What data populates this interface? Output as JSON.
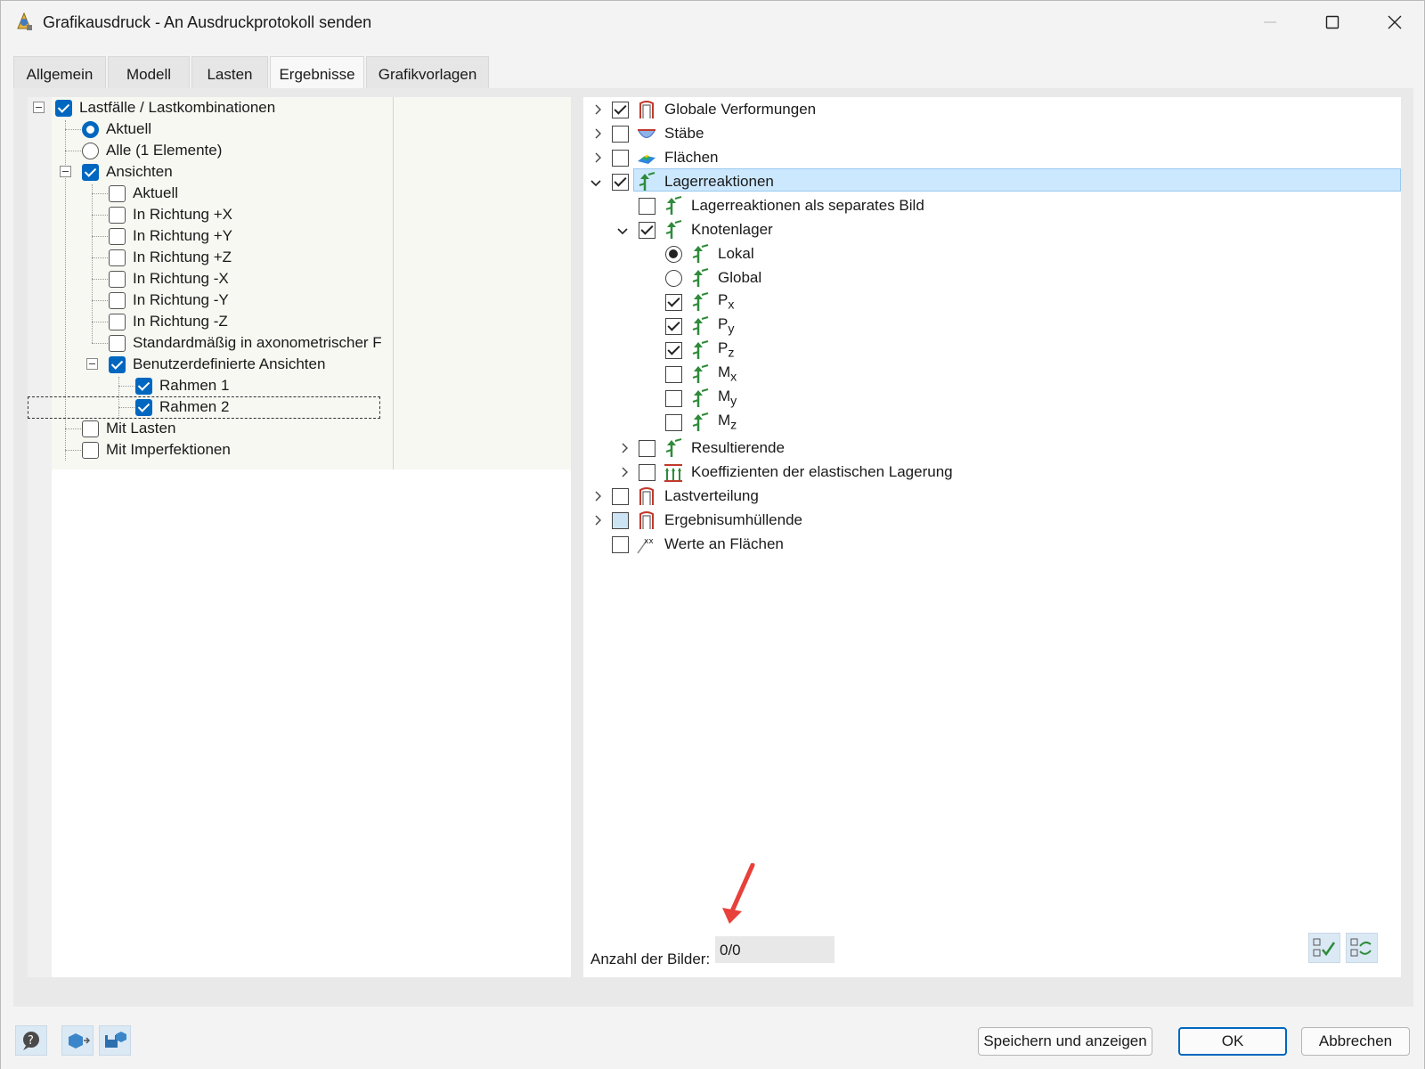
{
  "window": {
    "title": "Grafikausdruck - An Ausdruckprotokoll senden"
  },
  "tabs": [
    {
      "label": "Allgemein"
    },
    {
      "label": "Modell"
    },
    {
      "label": "Lasten"
    },
    {
      "label": "Ergebnisse",
      "active": true
    },
    {
      "label": "Grafikvorlagen"
    }
  ],
  "left_tree": [
    {
      "label": "Lastfälle / Lastkombinationen",
      "control": "checkbox",
      "checked": true
    },
    {
      "label": "Aktuell",
      "control": "radio",
      "checked": true
    },
    {
      "label": "Alle (1 Elemente)",
      "control": "radio",
      "checked": false
    },
    {
      "label": "Ansichten",
      "control": "checkbox",
      "checked": true
    },
    {
      "label": "Aktuell",
      "control": "checkbox",
      "checked": false
    },
    {
      "label": "In Richtung +X",
      "control": "checkbox",
      "checked": false
    },
    {
      "label": "In Richtung +Y",
      "control": "checkbox",
      "checked": false
    },
    {
      "label": "In Richtung +Z",
      "control": "checkbox",
      "checked": false
    },
    {
      "label": "In Richtung -X",
      "control": "checkbox",
      "checked": false
    },
    {
      "label": "In Richtung -Y",
      "control": "checkbox",
      "checked": false
    },
    {
      "label": "In Richtung -Z",
      "control": "checkbox",
      "checked": false
    },
    {
      "label": "Standardmäßig in axonometrischer F",
      "control": "checkbox",
      "checked": false
    },
    {
      "label": "Benutzerdefinierte Ansichten",
      "control": "checkbox",
      "checked": true
    },
    {
      "label": "Rahmen 1",
      "control": "checkbox",
      "checked": true
    },
    {
      "label": "Rahmen 2",
      "control": "checkbox",
      "checked": true,
      "focused": true
    },
    {
      "label": "Mit Lasten",
      "control": "checkbox",
      "checked": false
    },
    {
      "label": "Mit Imperfektionen",
      "control": "checkbox",
      "checked": false
    }
  ],
  "right_tree": [
    {
      "label": "Globale Verformungen",
      "expander": "collapsed",
      "checked": true,
      "icon": "frame-deformation-icon"
    },
    {
      "label": "Stäbe",
      "expander": "collapsed",
      "checked": false,
      "icon": "member-diagram-icon"
    },
    {
      "label": "Flächen",
      "expander": "collapsed",
      "checked": false,
      "icon": "surface-results-icon"
    },
    {
      "label": "Lagerreaktionen",
      "expander": "expanded",
      "checked": true,
      "selected": true,
      "icon": "support-reaction-icon"
    },
    {
      "label": "Lagerreaktionen als separates Bild",
      "checked": false,
      "icon": "support-reaction-icon"
    },
    {
      "label": "Knotenlager",
      "expander": "expanded",
      "checked": true,
      "icon": "support-reaction-icon"
    },
    {
      "label": "Lokal",
      "control": "radio",
      "checked": true,
      "icon": "support-reaction-icon"
    },
    {
      "label": "Global",
      "control": "radio",
      "checked": false,
      "icon": "support-reaction-icon"
    },
    {
      "label": "P",
      "sub": "x",
      "checked": true,
      "icon": "support-reaction-icon"
    },
    {
      "label": "P",
      "sub": "y",
      "checked": true,
      "icon": "support-reaction-icon"
    },
    {
      "label": "P",
      "sub": "z",
      "checked": true,
      "icon": "support-reaction-icon"
    },
    {
      "label": "M",
      "sub": "x",
      "checked": false,
      "icon": "support-reaction-icon"
    },
    {
      "label": "M",
      "sub": "y",
      "checked": false,
      "icon": "support-reaction-icon"
    },
    {
      "label": "M",
      "sub": "z",
      "checked": false,
      "icon": "support-reaction-icon"
    },
    {
      "label": "Resultierende",
      "expander": "collapsed",
      "checked": false,
      "icon": "support-reaction-icon"
    },
    {
      "label": "Koeffizienten der elastischen Lagerung",
      "expander": "collapsed",
      "checked": false,
      "icon": "elastic-foundation-icon"
    },
    {
      "label": "Lastverteilung",
      "expander": "collapsed",
      "checked": false,
      "icon": "frame-deformation-icon"
    },
    {
      "label": "Ergebnisumhüllende",
      "expander": "collapsed",
      "checked": "indeterminate",
      "icon": "frame-deformation-icon"
    },
    {
      "label": "Werte an Flächen",
      "checked": false,
      "icon": "surface-values-icon"
    }
  ],
  "footer": {
    "count_label": "Anzahl der Bilder:",
    "count_value": "0/0"
  },
  "buttons": {
    "save_show": "Speichern und anzeigen",
    "ok": "OK",
    "cancel": "Abbrechen"
  },
  "colors": {
    "accent": "#0067c0",
    "selection": "#cce8ff",
    "annotation_arrow": "#e8403a"
  }
}
